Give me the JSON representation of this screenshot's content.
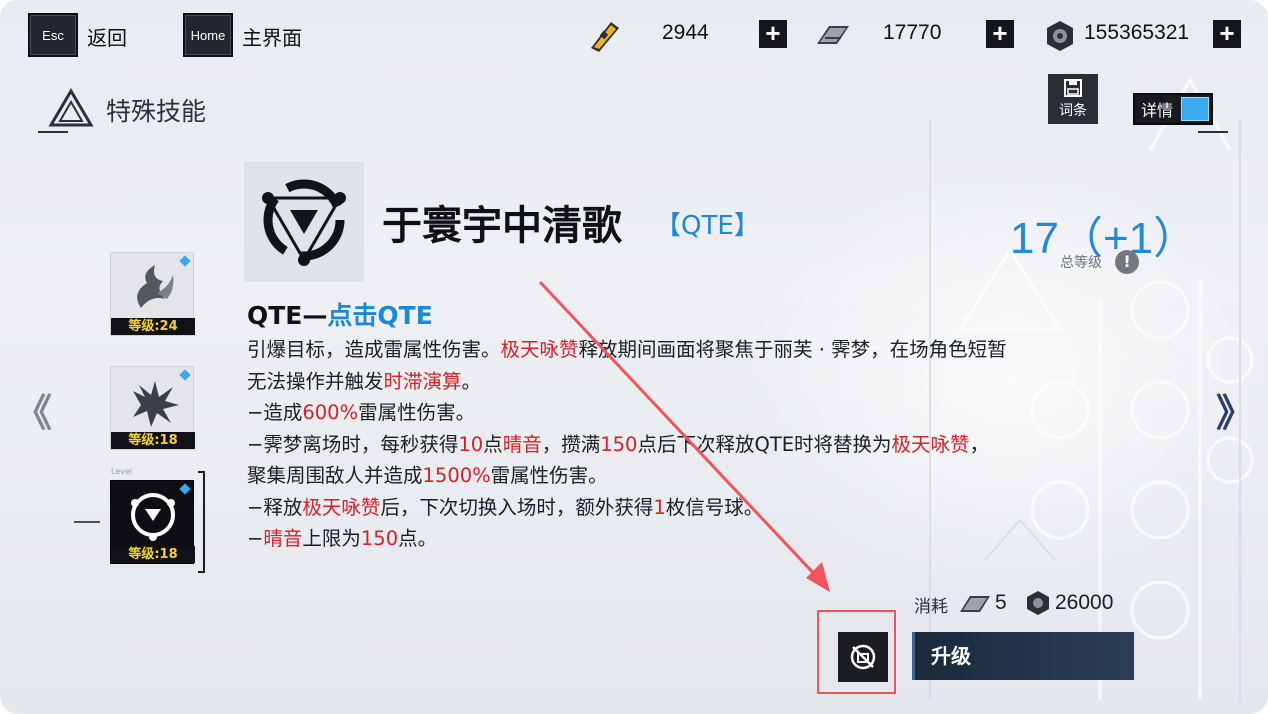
{
  "top_bar": {
    "esc_key": "Esc",
    "back_label": "返回",
    "home_key": "Home",
    "home_label": "主界面",
    "resources": [
      {
        "icon": "ticket-icon",
        "value": "2944"
      },
      {
        "icon": "chip-icon",
        "value": "17770"
      },
      {
        "icon": "coin-icon",
        "value": "155365321"
      }
    ],
    "plus_label": "+"
  },
  "header": {
    "title": "特殊技能",
    "term_button": "词条",
    "detail_toggle": "详情"
  },
  "skill_list": [
    {
      "level": "等级:24"
    },
    {
      "level": "等级:18"
    },
    {
      "level": "等级:18",
      "tag": "Level"
    }
  ],
  "skill": {
    "name": "于寰宇中清歌",
    "tag": "【QTE】",
    "level": "17（+1）",
    "level_label": "总等级",
    "info": "!",
    "desc_title_main": "QTE—",
    "desc_title_sub": "点击QTE",
    "desc_lines": [
      [
        {
          "t": "引爆目标，造成雷属性伤害。"
        },
        {
          "t": "极天咏赞",
          "hl": true
        },
        {
          "t": "释放期间画面将聚焦于丽芙 · 霁梦，在场角色短暂"
        }
      ],
      [
        {
          "t": "无法操作并触发"
        },
        {
          "t": "时滞演算",
          "hl": true
        },
        {
          "t": "。"
        }
      ],
      [
        {
          "t": "−造成"
        },
        {
          "t": "600%",
          "hl": true
        },
        {
          "t": "雷属性伤害。"
        }
      ],
      [
        {
          "t": "−霁梦离场时，每秒获得"
        },
        {
          "t": "10",
          "hl": true
        },
        {
          "t": "点"
        },
        {
          "t": "晴音",
          "hl": true
        },
        {
          "t": "，攒满"
        },
        {
          "t": "150",
          "hl": true
        },
        {
          "t": "点后下次释放QTE时将替换为"
        },
        {
          "t": "极天咏赞",
          "hl": true
        },
        {
          "t": "，"
        }
      ],
      [
        {
          "t": "聚集周围敌人并造成"
        },
        {
          "t": "1500%",
          "hl": true
        },
        {
          "t": "雷属性伤害。"
        }
      ],
      [
        {
          "t": "−释放"
        },
        {
          "t": "极天咏赞",
          "hl": true
        },
        {
          "t": "后，下次切换入场时，额外获得"
        },
        {
          "t": "1",
          "hl": true
        },
        {
          "t": "枚信号球。"
        }
      ],
      [
        {
          "t": "−"
        },
        {
          "t": "晴音",
          "hl": true
        },
        {
          "t": "上限为"
        },
        {
          "t": "150",
          "hl": true
        },
        {
          "t": "点。"
        }
      ]
    ]
  },
  "upgrade": {
    "cost_label": "消耗",
    "cost_chip": "5",
    "cost_coin": "26000",
    "button": "升级"
  },
  "nav": {
    "prev": "《",
    "next": "》"
  },
  "colors": {
    "accent": "#2588d6",
    "highlight": "#d2222a",
    "annotation": "#f0555f"
  }
}
